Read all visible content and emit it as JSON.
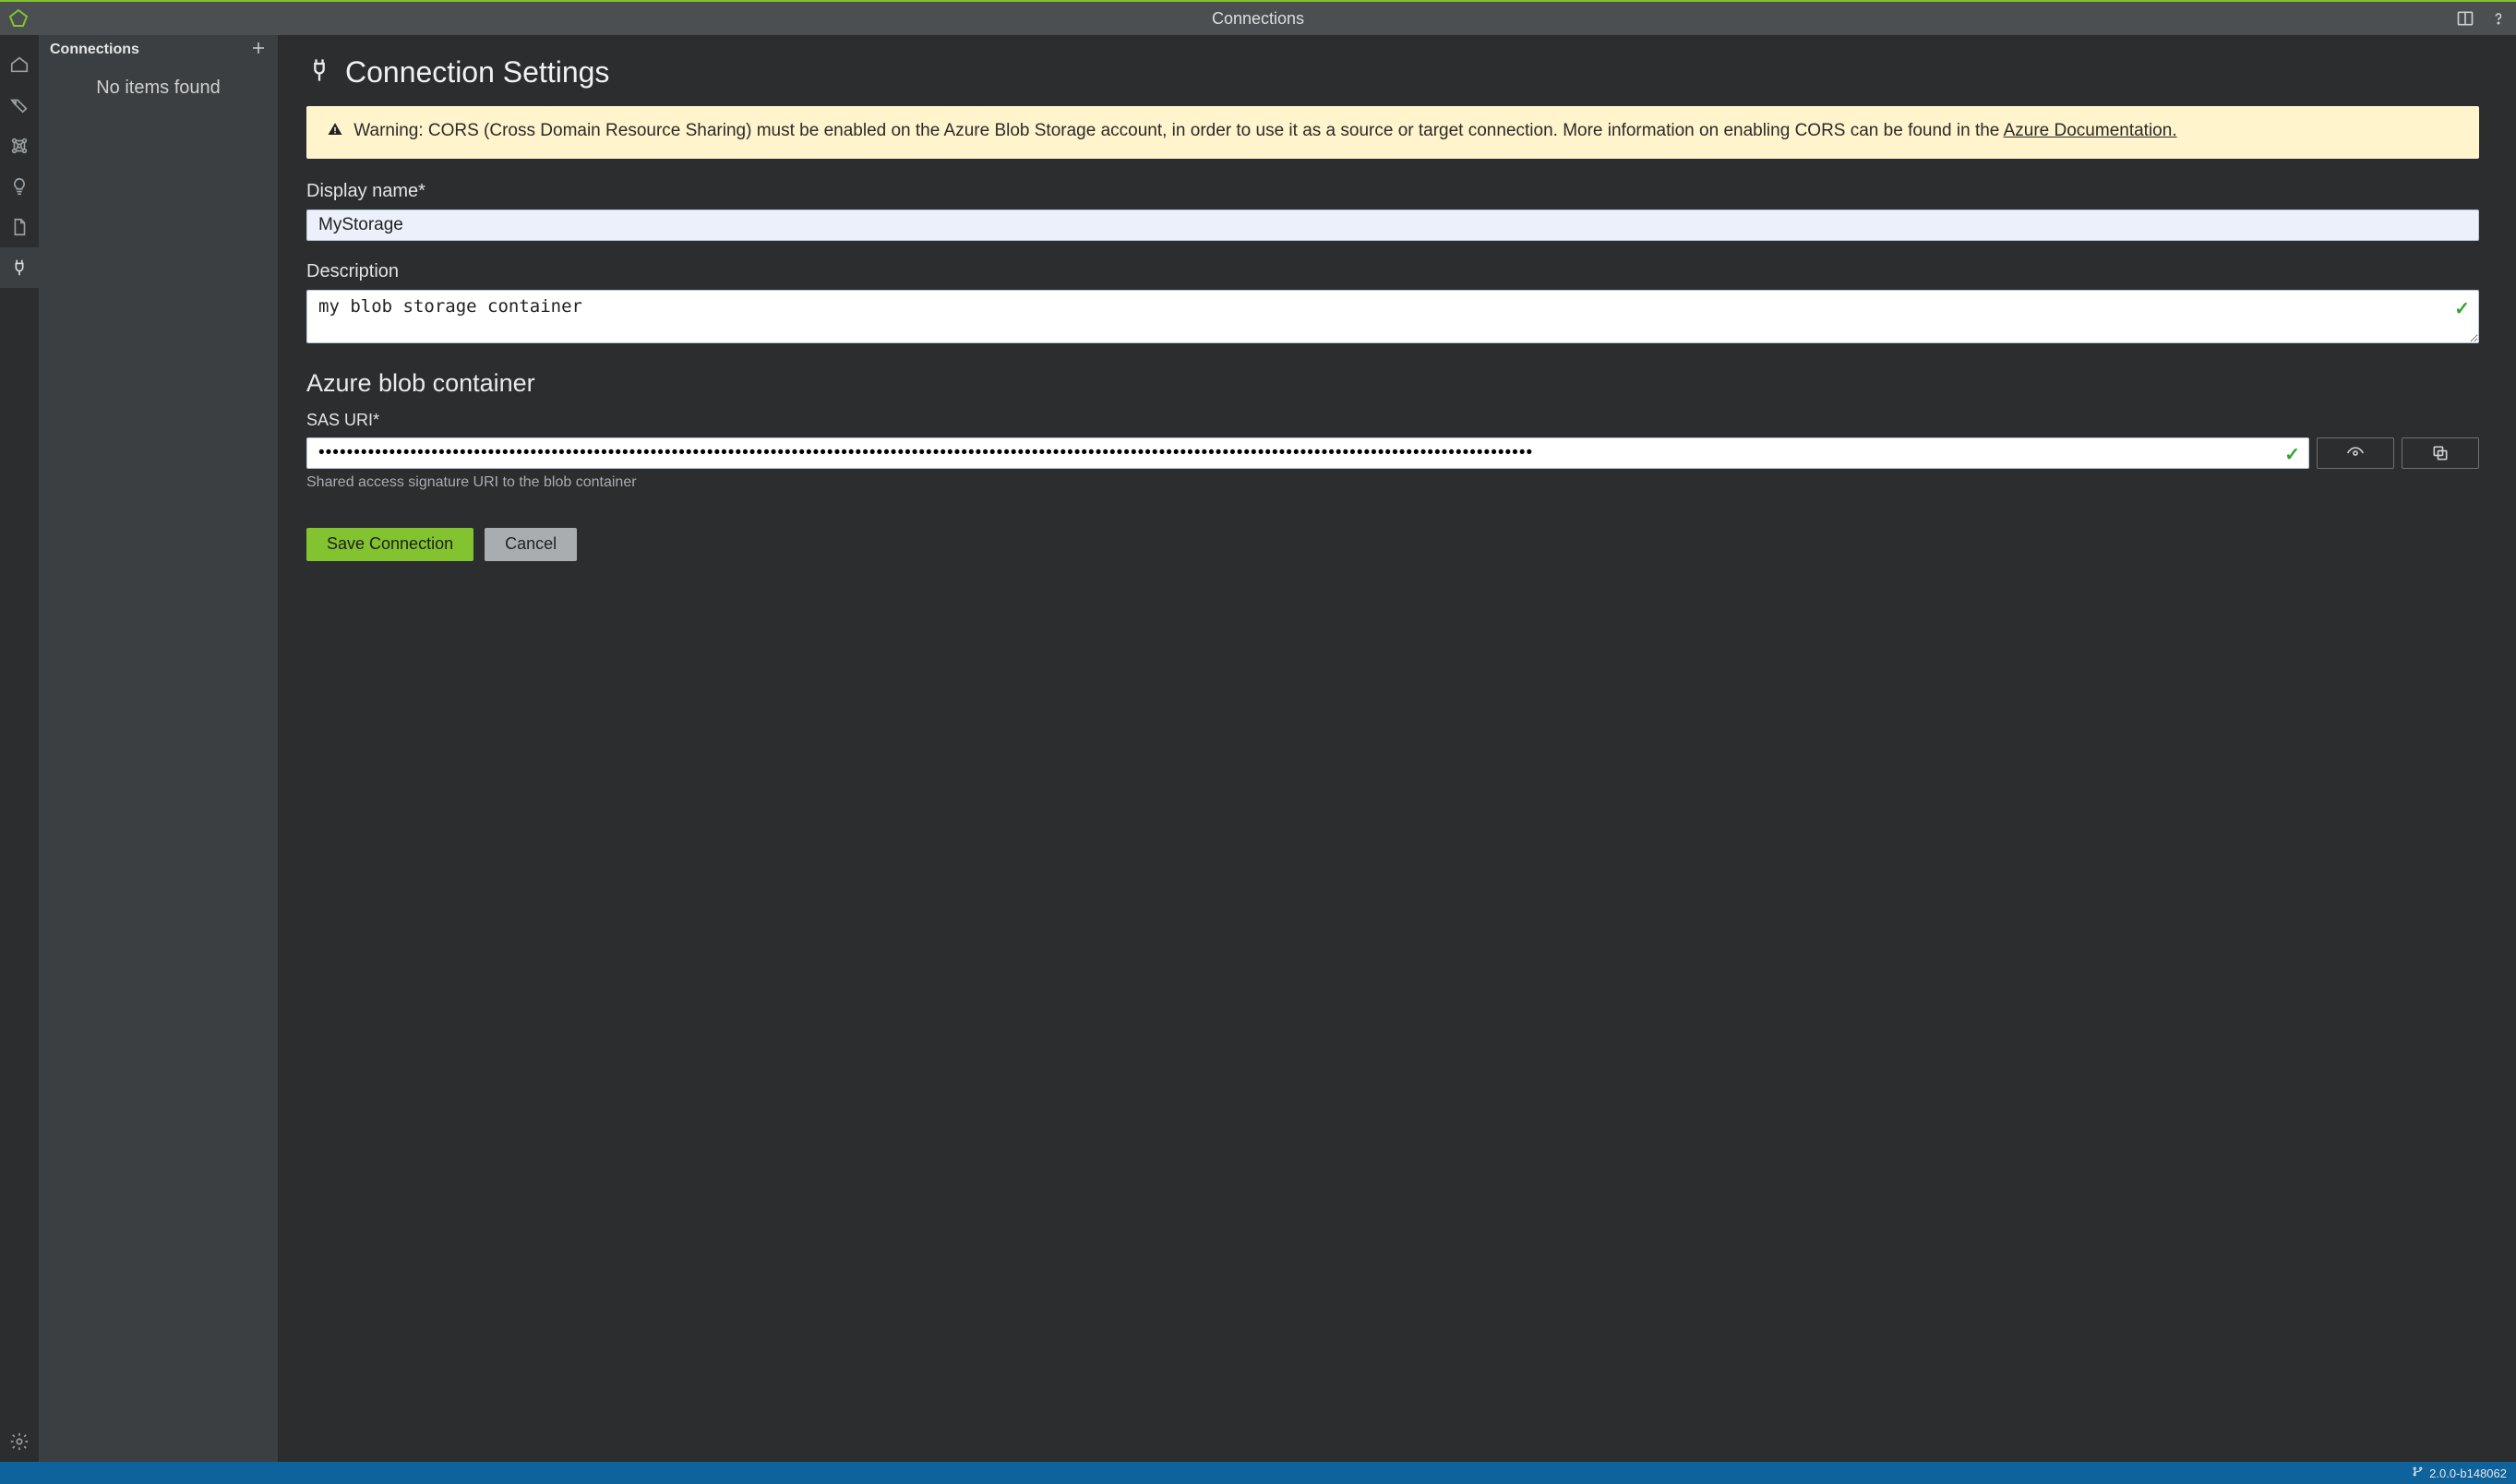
{
  "window": {
    "title": "Connections"
  },
  "sidepanel": {
    "header": "Connections",
    "empty_text": "No items found"
  },
  "page": {
    "heading": "Connection Settings",
    "alert_prefix": "Warning: CORS (Cross Domain Resource Sharing) must be enabled on the Azure Blob Storage account, in order to use it as a source or target connection. More information on enabling CORS can be found in the ",
    "alert_link": "Azure Documentation."
  },
  "form": {
    "display_name_label": "Display name*",
    "display_name_value": "MyStorage",
    "description_label": "Description",
    "description_value": "my blob storage container",
    "provider_section": "Azure blob container",
    "sas_label": "SAS URI*",
    "sas_value": "••••••••••••••••••••••••••••••••••••••••••••••••••••••••••••••••••••••••••••••••••••••••••••••••••••••••••••••••••••••••••••••••••••••••••••••••••••••••••••••••••••••••••••",
    "sas_help": "Shared access signature URI to the blob container"
  },
  "buttons": {
    "save": "Save Connection",
    "cancel": "Cancel"
  },
  "status": {
    "version": "2.0.0-b148062"
  },
  "colors": {
    "accent": "#82c32f",
    "statusbar": "#0e639c",
    "alert_bg": "#fff4cc"
  }
}
